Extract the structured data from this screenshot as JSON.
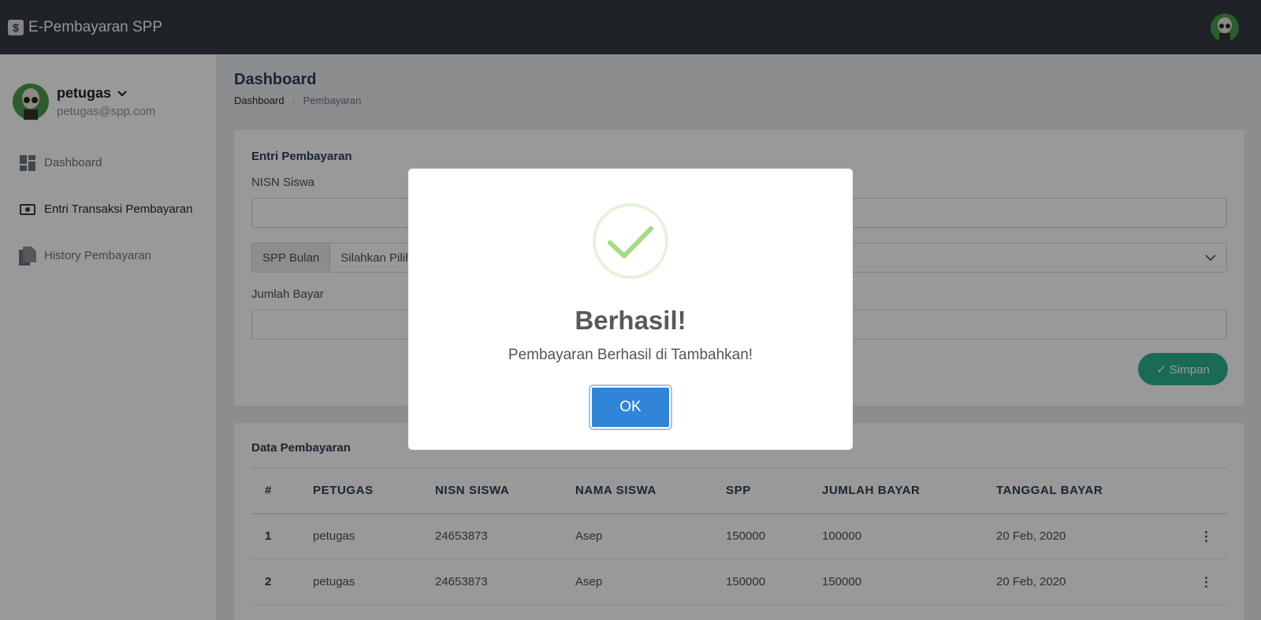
{
  "app": {
    "title": "E-Pembayaran SPP",
    "brand_icon": "$"
  },
  "user": {
    "name": "petugas",
    "email": "petugas@spp.com"
  },
  "sidebar": {
    "items": [
      {
        "label": "Dashboard",
        "icon": "dashboard-icon"
      },
      {
        "label": "Entri Transaksi Pembayaran",
        "icon": "money-icon"
      },
      {
        "label": "History Pembayaran",
        "icon": "file-copy-icon"
      }
    ]
  },
  "page": {
    "title": "Dashboard",
    "breadcrumb": [
      "Dashboard",
      "Pembayaran"
    ]
  },
  "form": {
    "title": "Entri Pembayaran",
    "nisn_label": "NISN Siswa",
    "nisn_value": "",
    "spp_prepend": "SPP Bulan",
    "spp_selected": "Silahkan Pilih",
    "jumlah_label": "Jumlah Bayar",
    "jumlah_value": "",
    "save_label": "✓ Simpan"
  },
  "table": {
    "title": "Data Pembayaran",
    "headers": [
      "#",
      "PETUGAS",
      "NISN SISWA",
      "NAMA SISWA",
      "SPP",
      "JUMLAH BAYAR",
      "TANGGAL BAYAR"
    ],
    "rows": [
      [
        "1",
        "petugas",
        "24653873",
        "Asep",
        "150000",
        "100000",
        "20 Feb, 2020"
      ],
      [
        "2",
        "petugas",
        "24653873",
        "Asep",
        "150000",
        "150000",
        "20 Feb, 2020"
      ]
    ]
  },
  "modal": {
    "title": "Berhasil!",
    "text": "Pembayaran Berhasil di Tambahkan!",
    "ok_label": "OK",
    "icon": "success-check-icon"
  },
  "colors": {
    "topbar": "#343a40",
    "accent_green": "#2bb38f",
    "ok_blue": "#3085d6",
    "check_green": "#a5dc86"
  }
}
